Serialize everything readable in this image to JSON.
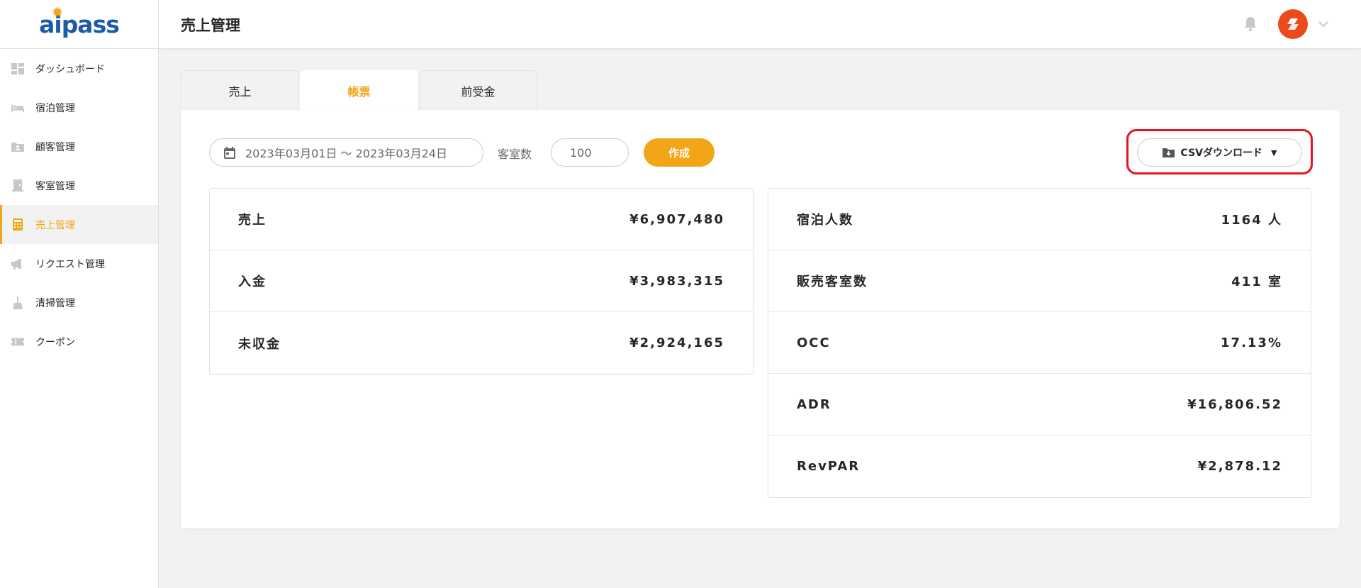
{
  "app": {
    "logo": "aipass",
    "page_title": "売上管理"
  },
  "sidebar": {
    "items": [
      {
        "label": "ダッシュボード",
        "icon": "dashboard-icon"
      },
      {
        "label": "宿泊管理",
        "icon": "bed-icon"
      },
      {
        "label": "顧客管理",
        "icon": "customer-folder-icon"
      },
      {
        "label": "客室管理",
        "icon": "door-icon"
      },
      {
        "label": "売上管理",
        "icon": "calculator-icon",
        "active": true
      },
      {
        "label": "リクエスト管理",
        "icon": "megaphone-icon"
      },
      {
        "label": "清掃管理",
        "icon": "broom-icon"
      },
      {
        "label": "クーポン",
        "icon": "ticket-icon"
      }
    ]
  },
  "tabs": [
    {
      "label": "売上",
      "active": false
    },
    {
      "label": "帳票",
      "active": true
    },
    {
      "label": "前受金",
      "active": false
    }
  ],
  "filters": {
    "date_range": "2023年03月01日 ～ 2023年03月24日",
    "rooms_label": "客室数",
    "rooms_value": "100",
    "create_label": "作成",
    "csv_label": "CSVダウンロード"
  },
  "summary_left": [
    {
      "label": "売上",
      "value": "¥6,907,480"
    },
    {
      "label": "入金",
      "value": "¥3,983,315"
    },
    {
      "label": "未収金",
      "value": "¥2,924,165"
    }
  ],
  "summary_right": [
    {
      "label": "宿泊人数",
      "value": "1164 人"
    },
    {
      "label": "販売客室数",
      "value": "411 室"
    },
    {
      "label": "OCC",
      "value": "17.13%"
    },
    {
      "label": "ADR",
      "value": "¥16,806.52"
    },
    {
      "label": "RevPAR",
      "value": "¥2,878.12"
    }
  ],
  "colors": {
    "accent": "#f2a516",
    "brand": "#1d5aa8",
    "highlight": "#e8131e",
    "avatar": "#ec4a1c"
  }
}
